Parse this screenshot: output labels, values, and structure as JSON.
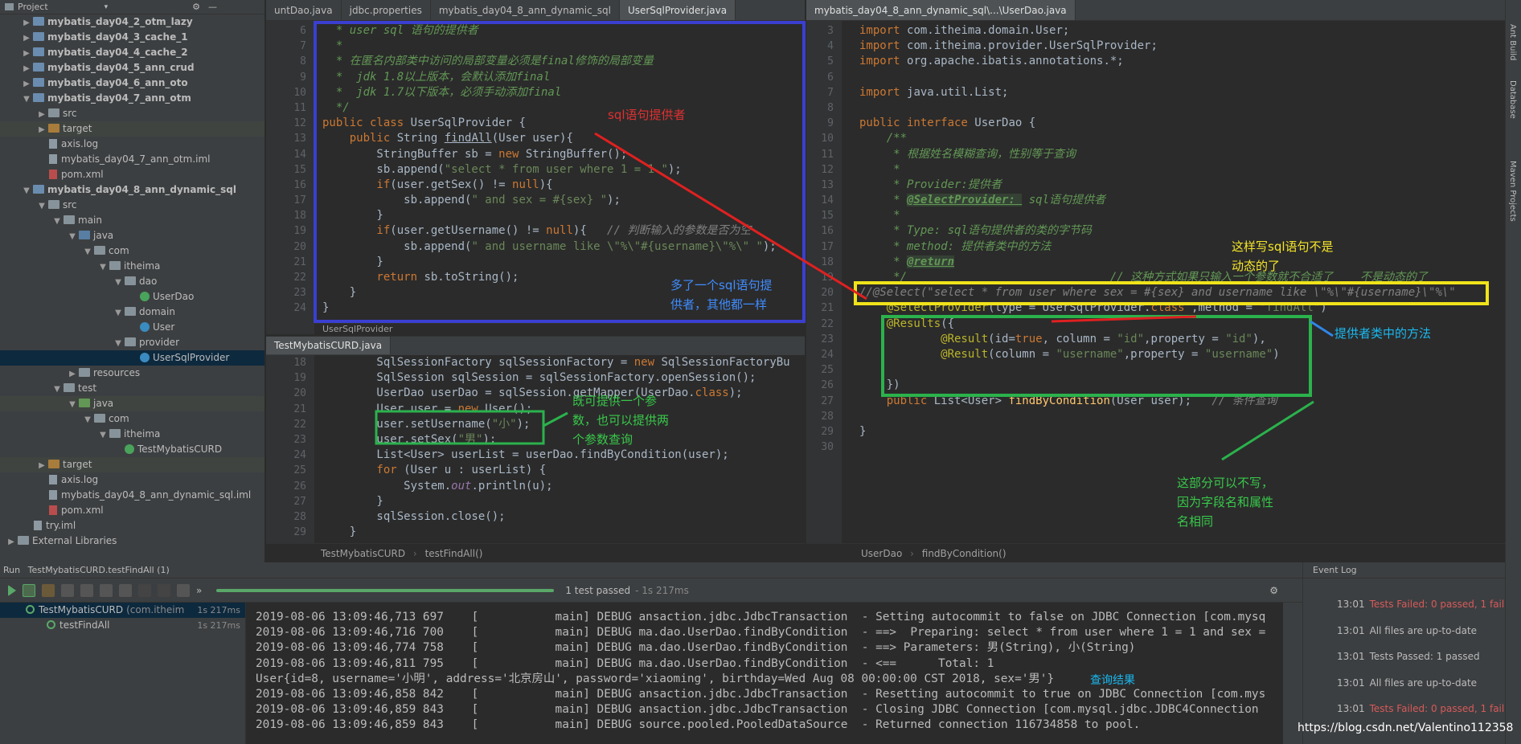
{
  "project": {
    "title": "Project",
    "tree": [
      {
        "label": "mybatis_day04_2_otm_lazy",
        "depth": 1,
        "type": "module",
        "arrow": "right",
        "bold": true
      },
      {
        "label": "mybatis_day04_3_cache_1",
        "depth": 1,
        "type": "module",
        "arrow": "right",
        "bold": true
      },
      {
        "label": "mybatis_day04_4_cache_2",
        "depth": 1,
        "type": "module",
        "arrow": "right",
        "bold": true
      },
      {
        "label": "mybatis_day04_5_ann_crud",
        "depth": 1,
        "type": "module",
        "arrow": "right",
        "bold": true
      },
      {
        "label": "mybatis_day04_6_ann_oto",
        "depth": 1,
        "type": "module",
        "arrow": "right",
        "bold": true
      },
      {
        "label": "mybatis_day04_7_ann_otm",
        "depth": 1,
        "type": "module",
        "arrow": "down",
        "bold": true
      },
      {
        "label": "src",
        "depth": 2,
        "type": "folder",
        "arrow": "right"
      },
      {
        "label": "target",
        "depth": 2,
        "type": "folder-orange",
        "arrow": "right",
        "highlight": true
      },
      {
        "label": "axis.log",
        "depth": 2,
        "type": "file"
      },
      {
        "label": "mybatis_day04_7_ann_otm.iml",
        "depth": 2,
        "type": "file"
      },
      {
        "label": "pom.xml",
        "depth": 2,
        "type": "maven"
      },
      {
        "label": "mybatis_day04_8_ann_dynamic_sql",
        "depth": 1,
        "type": "module",
        "arrow": "down",
        "bold": true
      },
      {
        "label": "src",
        "depth": 2,
        "type": "folder",
        "arrow": "down"
      },
      {
        "label": "main",
        "depth": 3,
        "type": "folder",
        "arrow": "down"
      },
      {
        "label": "java",
        "depth": 4,
        "type": "folder-src",
        "arrow": "down"
      },
      {
        "label": "com",
        "depth": 5,
        "type": "folder",
        "arrow": "down"
      },
      {
        "label": "itheima",
        "depth": 6,
        "type": "folder",
        "arrow": "down"
      },
      {
        "label": "dao",
        "depth": 7,
        "type": "folder",
        "arrow": "down"
      },
      {
        "label": "UserDao",
        "depth": 8,
        "type": "interface"
      },
      {
        "label": "domain",
        "depth": 7,
        "type": "folder",
        "arrow": "down"
      },
      {
        "label": "User",
        "depth": 8,
        "type": "class"
      },
      {
        "label": "provider",
        "depth": 7,
        "type": "folder",
        "arrow": "down"
      },
      {
        "label": "UserSqlProvider",
        "depth": 8,
        "type": "class",
        "selected": true
      },
      {
        "label": "resources",
        "depth": 4,
        "type": "folder",
        "arrow": "right"
      },
      {
        "label": "test",
        "depth": 3,
        "type": "folder",
        "arrow": "down"
      },
      {
        "label": "java",
        "depth": 4,
        "type": "folder-green",
        "arrow": "down",
        "highlight": true
      },
      {
        "label": "com",
        "depth": 5,
        "type": "folder",
        "arrow": "down"
      },
      {
        "label": "itheima",
        "depth": 6,
        "type": "folder",
        "arrow": "down"
      },
      {
        "label": "TestMybatisCURD",
        "depth": 7,
        "type": "class-green"
      },
      {
        "label": "target",
        "depth": 2,
        "type": "folder-orange",
        "arrow": "right",
        "highlight": true
      },
      {
        "label": "axis.log",
        "depth": 2,
        "type": "file"
      },
      {
        "label": "mybatis_day04_8_ann_dynamic_sql.iml",
        "depth": 2,
        "type": "file"
      },
      {
        "label": "pom.xml",
        "depth": 2,
        "type": "maven"
      },
      {
        "label": "try.iml",
        "depth": 1,
        "type": "file"
      },
      {
        "label": "External Libraries",
        "depth": 0,
        "type": "lib",
        "arrow": "right"
      }
    ]
  },
  "editor_left": {
    "tabs": [
      "untDao.java",
      "jdbc.properties",
      "mybatis_day04_8_ann_dynamic_sql",
      "UserSqlProvider.java"
    ],
    "active_tab": 3,
    "line_numbers": [
      "6",
      "7",
      "8",
      "9",
      "10",
      "11",
      "12",
      "13",
      "14",
      "15",
      "16",
      "17",
      "18",
      "19",
      "20",
      "21",
      "22",
      "23",
      "24"
    ],
    "breadcrumb": "UserSqlProvider"
  },
  "editor_test": {
    "tab": "TestMybatisCURD.java",
    "line_numbers": [
      "18",
      "19",
      "20",
      "21",
      "22",
      "23",
      "24",
      "25",
      "26",
      "27",
      "28",
      "29"
    ],
    "breadcrumb": [
      "TestMybatisCURD",
      "testFindAll()"
    ]
  },
  "editor_right": {
    "tab": "mybatis_day04_8_ann_dynamic_sql\\...\\UserDao.java",
    "line_numbers": [
      "3",
      "4",
      "5",
      "6",
      "7",
      "8",
      "9",
      "10",
      "11",
      "12",
      "13",
      "14",
      "15",
      "16",
      "17",
      "18",
      "19",
      "20",
      "21",
      "22",
      "23",
      "24",
      "25",
      "26",
      "27",
      "28",
      "29",
      "30"
    ],
    "breadcrumb": [
      "UserDao",
      "findByCondition()"
    ]
  },
  "run": {
    "title": "Run",
    "config": "TestMybatisCURD.testFindAll (1)",
    "status": "1 test passed",
    "duration": "- 1s 217ms",
    "tree": [
      {
        "label": "TestMybatisCURD",
        "sub": "(com.itheim",
        "time": "1s 217ms"
      },
      {
        "label": "testFindAll",
        "sub": "",
        "time": "1s 217ms"
      }
    ],
    "console": [
      "2019-08-06 13:09:46,713 697    [           main] DEBUG ansaction.jdbc.JdbcTransaction  - Setting autocommit to false on JDBC Connection [com.mysq",
      "2019-08-06 13:09:46,716 700    [           main] DEBUG ma.dao.UserDao.findByCondition  - ==>  Preparing: select * from user where 1 = 1 and sex =",
      "2019-08-06 13:09:46,774 758    [           main] DEBUG ma.dao.UserDao.findByCondition  - ==> Parameters: 男(String), 小(String)",
      "2019-08-06 13:09:46,811 795    [           main] DEBUG ma.dao.UserDao.findByCondition  - <==      Total: 1",
      "User{id=8, username='小明', address='北京房山', password='xiaoming', birthday=Wed Aug 08 00:00:00 CST 2018, sex='男'}",
      "2019-08-06 13:09:46,858 842    [           main] DEBUG ansaction.jdbc.JdbcTransaction  - Resetting autocommit to true on JDBC Connection [com.mys",
      "2019-08-06 13:09:46,859 843    [           main] DEBUG ansaction.jdbc.JdbcTransaction  - Closing JDBC Connection [com.mysql.jdbc.JDBC4Connection",
      "2019-08-06 13:09:46,859 843    [           main] DEBUG source.pooled.PooledDataSource  - Returned connection 116734858 to pool."
    ]
  },
  "event_log": {
    "title": "Event Log",
    "entries": [
      {
        "time": "13:01",
        "text": "Tests Failed: 0 passed, 1 failed",
        "color": "#d75a5a"
      },
      {
        "time": "13:01",
        "text": "All files are up-to-date",
        "color": "#bbbbbb"
      },
      {
        "time": "13:01",
        "text": "Tests Passed: 1 passed",
        "color": "#bbbbbb"
      },
      {
        "time": "13:01",
        "text": "All files are up-to-date",
        "color": "#bbbbbb"
      },
      {
        "time": "13:01",
        "text": "Tests Failed: 0 passed, 1 failed",
        "color": "#d75a5a"
      }
    ]
  },
  "side_stripe": [
    "Ant Build",
    "Database",
    "Maven Projects"
  ],
  "annotations": {
    "sql_provider": "sql语句提供者",
    "extra_provider_1": "多了一个sql语句提",
    "extra_provider_2": "供者，其他都一样",
    "params_1": "既可提供一个参",
    "params_2": "数，也可以提供两",
    "params_3": "个参数查询",
    "not_dynamic_1": "这样写sql语句不是",
    "not_dynamic_2": "动态的了",
    "provider_method": "提供者类中的方法",
    "optional_1": "这部分可以不写，",
    "optional_2": "因为字段名和属性",
    "optional_3": "名相同",
    "query_result": "查询结果"
  },
  "watermark": "https://blog.csdn.net/Valentino112358"
}
